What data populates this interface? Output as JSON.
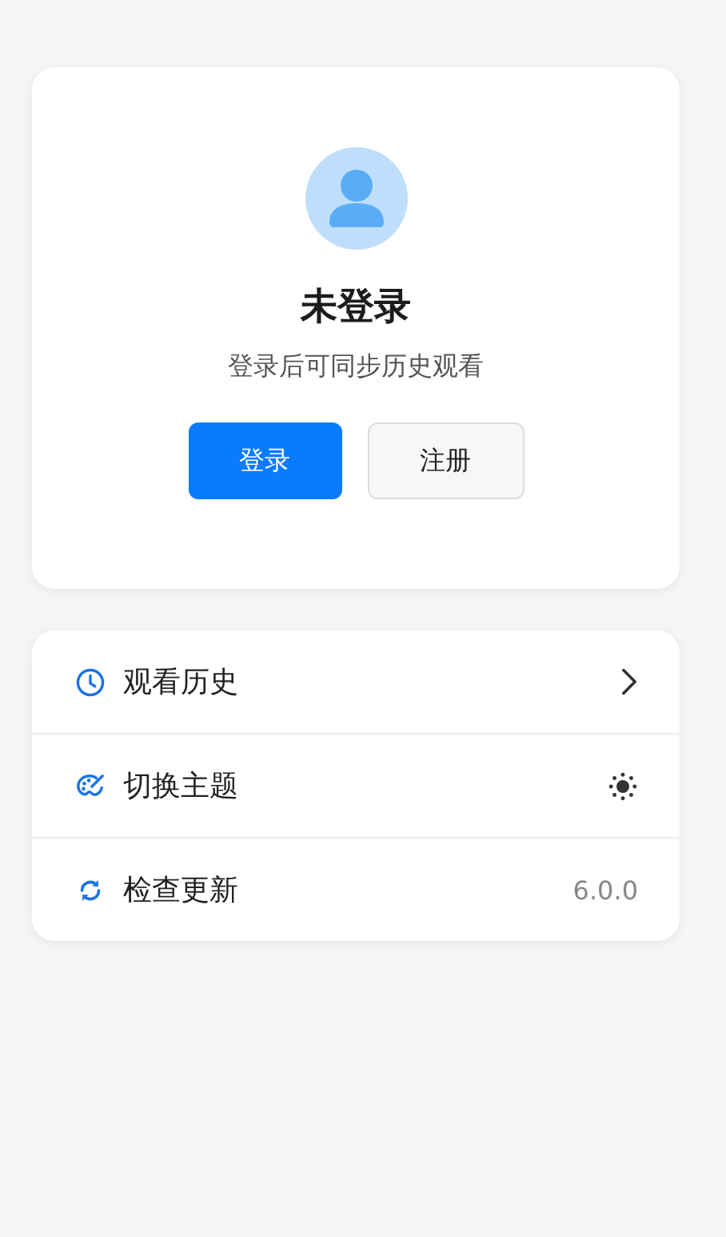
{
  "profile": {
    "title": "未登录",
    "subtitle": "登录后可同步历史观看",
    "buttons": [
      {
        "label": "登录",
        "kind": "primary"
      },
      {
        "label": "注册",
        "kind": "secondary"
      }
    ]
  },
  "menu": [
    {
      "label": "观看历史",
      "kind": "chevron"
    },
    {
      "label": "切换主题",
      "kind": "theme"
    },
    {
      "label": "检查更新",
      "kind": "value",
      "value": "6.0.0"
    }
  ]
}
